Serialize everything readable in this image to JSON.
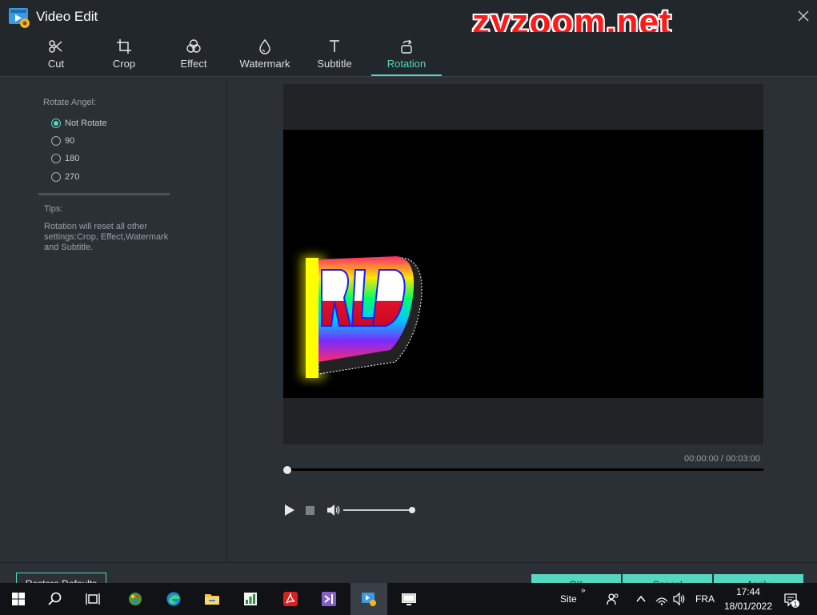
{
  "window": {
    "title": "Video Edit"
  },
  "overlay": {
    "watermark": "zyzoom.net"
  },
  "tabs": [
    {
      "label": "Cut",
      "icon": "scissors-icon"
    },
    {
      "label": "Crop",
      "icon": "crop-icon"
    },
    {
      "label": "Effect",
      "icon": "effect-icon"
    },
    {
      "label": "Watermark",
      "icon": "droplet-icon"
    },
    {
      "label": "Subtitle",
      "icon": "text-icon"
    },
    {
      "label": "Rotation",
      "icon": "rotate-icon",
      "active": true
    }
  ],
  "rotation": {
    "section_label": "Rotate Angel:",
    "options": [
      {
        "label": "Not Rotate",
        "checked": true
      },
      {
        "label": "90",
        "checked": false
      },
      {
        "label": "180",
        "checked": false
      },
      {
        "label": "270",
        "checked": false
      }
    ],
    "tips_label": "Tips:",
    "tips_text": "Rotation will reset all other settings:Crop, Effect,Watermark and Subtitle."
  },
  "player": {
    "time_readout": "00:00:00 / 00:03:00",
    "progress": 0,
    "volume": 1.0
  },
  "bottom_buttons": {
    "restore": "Restore Defaults",
    "ok": "OK",
    "cancel": "Cancel",
    "apply": "Apply"
  },
  "taskbar": {
    "site_label": "Site",
    "site_arrow": "»",
    "language": "FRA",
    "time": "17:44",
    "date": "18/01/2022",
    "notification_count": "1"
  },
  "colors": {
    "accent": "#55d6c1",
    "watermark": "#ff1a1a",
    "background": "#2b3035"
  }
}
